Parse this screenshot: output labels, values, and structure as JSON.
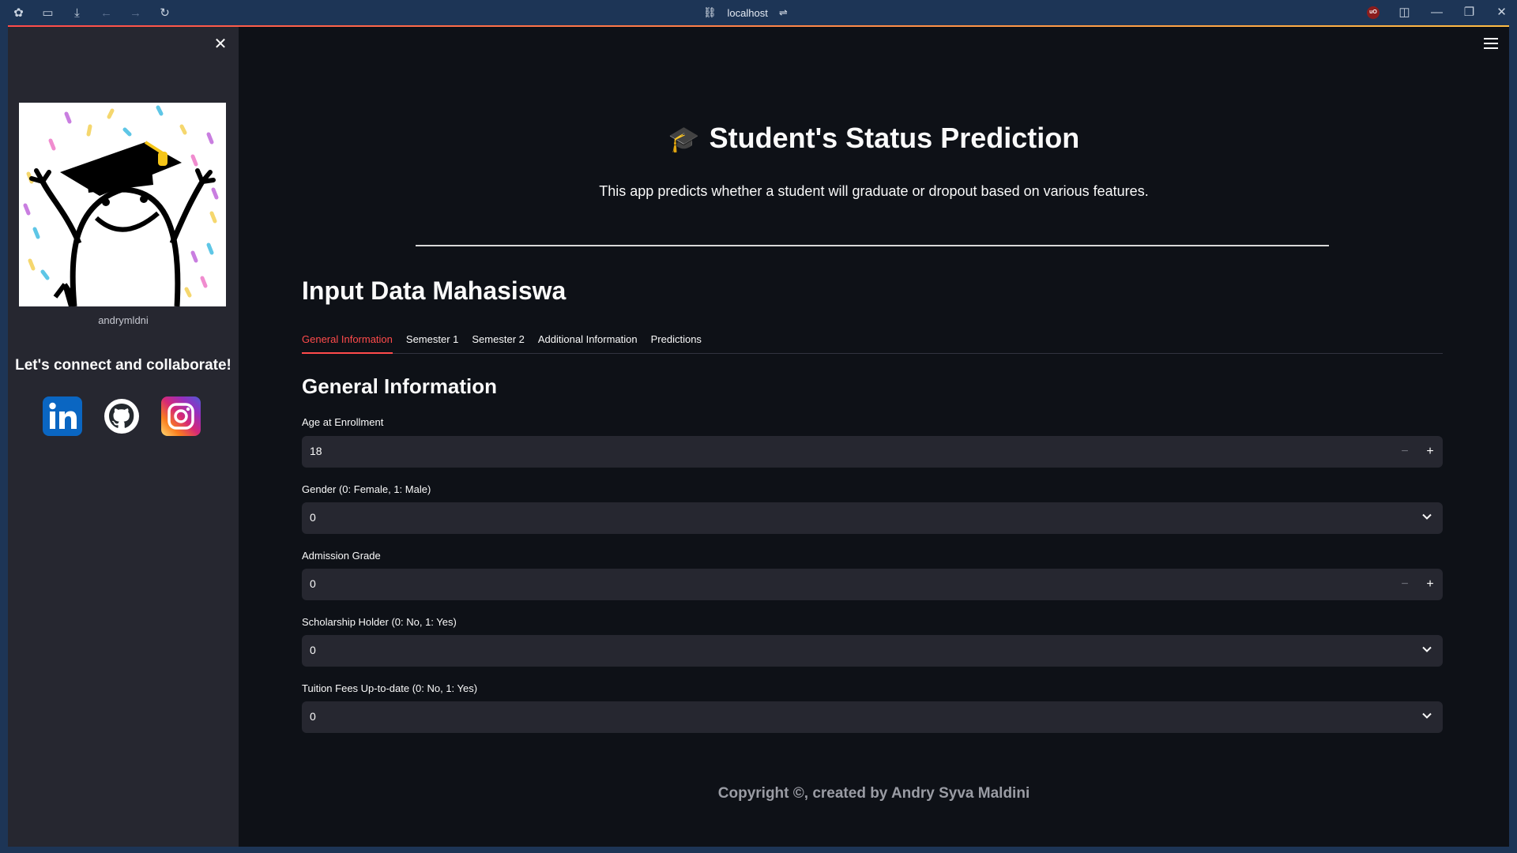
{
  "browser": {
    "url": "localhost",
    "icons": [
      "extensions-icon",
      "sidebar-icon",
      "download-icon",
      "back-icon",
      "forward-icon",
      "reload-icon"
    ]
  },
  "sidebar": {
    "username": "andrymldni",
    "connect_text": "Let's connect and collaborate!",
    "socials": [
      "linkedin",
      "github",
      "instagram"
    ]
  },
  "header": {
    "title": "Student's Status Prediction",
    "subtitle": "This app predicts whether a student will graduate or dropout based on various features."
  },
  "main": {
    "section_title": "Input Data Mahasiswa",
    "tabs": [
      {
        "label": "General Information",
        "active": true
      },
      {
        "label": "Semester 1",
        "active": false
      },
      {
        "label": "Semester 2",
        "active": false
      },
      {
        "label": "Additional Information",
        "active": false
      },
      {
        "label": "Predictions",
        "active": false
      }
    ],
    "subsection_title": "General Information",
    "fields": [
      {
        "label": "Age at Enrollment",
        "value": "18",
        "type": "number"
      },
      {
        "label": "Gender (0: Female, 1: Male)",
        "value": "0",
        "type": "select"
      },
      {
        "label": "Admission Grade",
        "value": "0",
        "type": "number"
      },
      {
        "label": "Scholarship Holder (0: No, 1: Yes)",
        "value": "0",
        "type": "select"
      },
      {
        "label": "Tuition Fees Up-to-date (0: No, 1: Yes)",
        "value": "0",
        "type": "select"
      }
    ]
  },
  "footer": {
    "text": "Copyright ©, created by Andry Syva Maldini"
  },
  "colors": {
    "accent": "#ff4b4b",
    "background": "#0e1117",
    "sidebar": "#262730"
  }
}
